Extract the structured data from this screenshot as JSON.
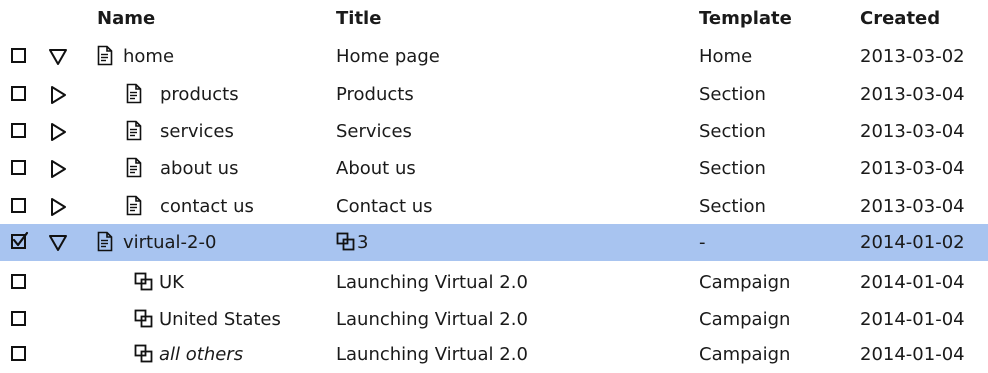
{
  "header": {
    "name": "Name",
    "title": "Title",
    "template": "Template",
    "created": "Created"
  },
  "rows": [
    {
      "name": "home",
      "title": "Home page",
      "template": "Home",
      "created": "2013-03-02",
      "checked": false,
      "expander": "expanded"
    },
    {
      "name": "products",
      "title": "Products",
      "template": "Section",
      "created": "2013-03-04",
      "checked": false,
      "expander": "collapsed"
    },
    {
      "name": "services",
      "title": "Services",
      "template": "Section",
      "created": "2013-03-04",
      "checked": false,
      "expander": "collapsed"
    },
    {
      "name": "about us",
      "title": "About us",
      "template": "Section",
      "created": "2013-03-04",
      "checked": false,
      "expander": "collapsed"
    },
    {
      "name": "contact us",
      "title": "Contact us",
      "template": "Section",
      "created": "2013-03-04",
      "checked": false,
      "expander": "collapsed"
    },
    {
      "name": "virtual-2-0",
      "title": "3",
      "template": "-",
      "created": "2014-01-02",
      "checked": true,
      "expander": "expanded",
      "selected": true
    },
    {
      "name": "UK",
      "title": "Launching Virtual 2.0",
      "template": "Campaign",
      "created": "2014-01-04",
      "checked": false
    },
    {
      "name": "United States",
      "title": "Launching Virtual 2.0",
      "template": "Campaign",
      "created": "2014-01-04",
      "checked": false
    },
    {
      "name": "all others",
      "title": "Launching Virtual 2.0",
      "template": "Campaign",
      "created": "2014-01-04",
      "checked": false
    }
  ],
  "icons": {
    "page": "document-icon",
    "variant": "linked-copies-icon",
    "expanded": "triangle-down-icon",
    "collapsed": "triangle-right-icon"
  },
  "colors": {
    "selected_row": "#a8c4f0"
  }
}
